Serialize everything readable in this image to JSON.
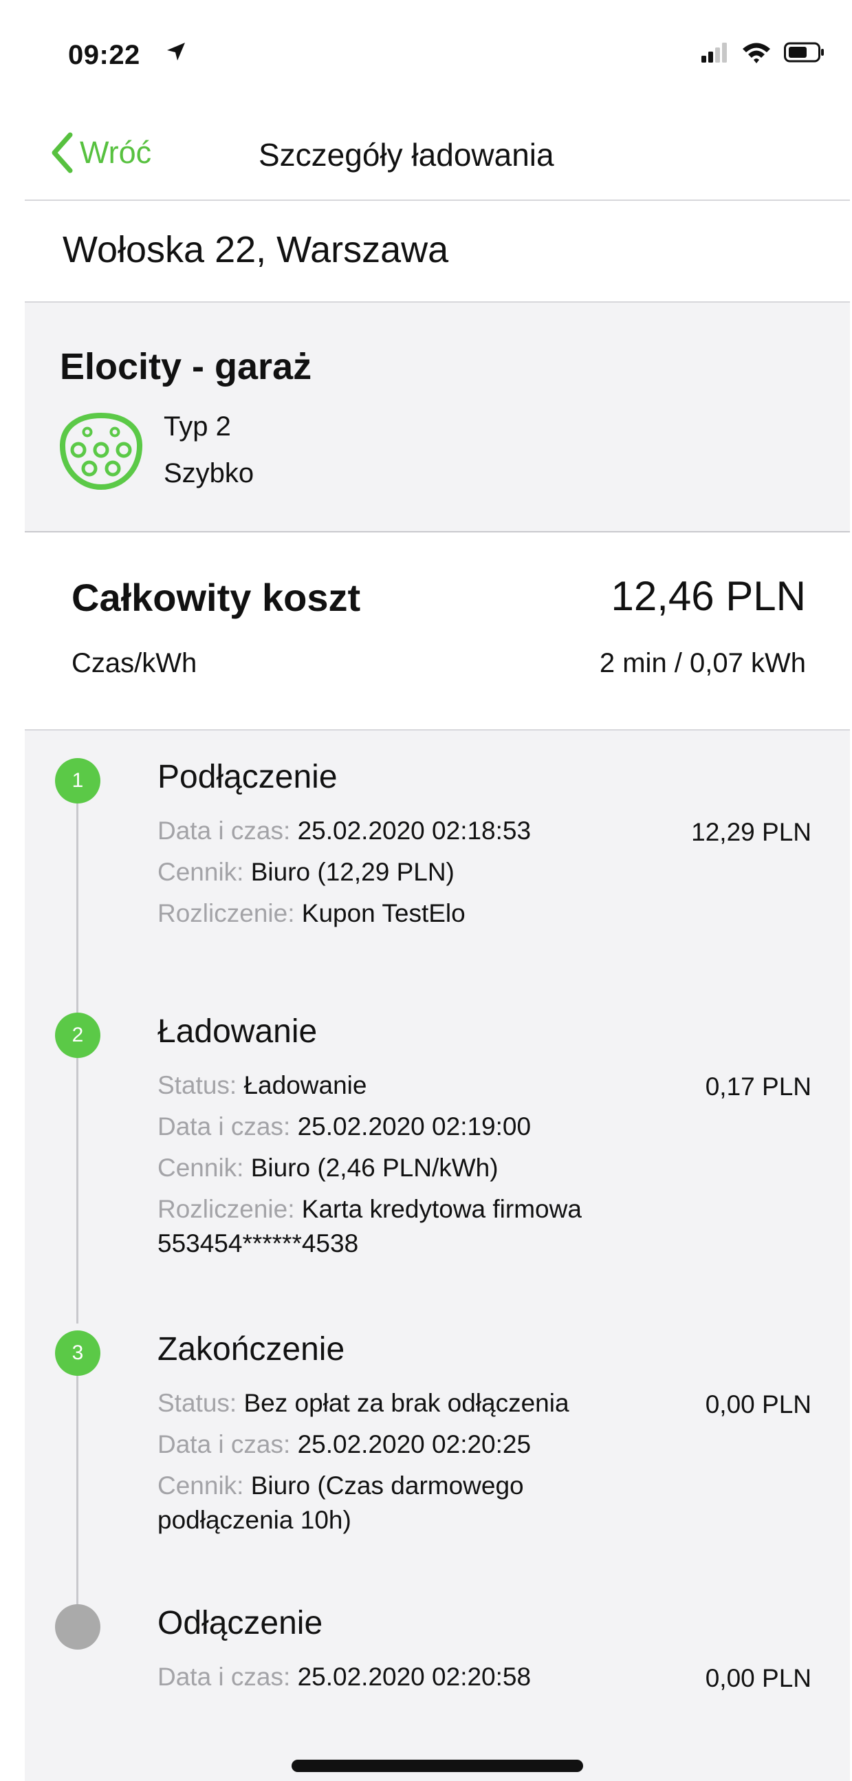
{
  "status_bar": {
    "time": "09:22"
  },
  "nav": {
    "back_label": "Wróć",
    "title": "Szczegóły ładowania"
  },
  "address": "Wołoska 22, Warszawa",
  "station": {
    "name": "Elocity - garaż",
    "plug_type": "Typ 2",
    "speed": "Szybko"
  },
  "summary": {
    "total_label": "Całkowity koszt",
    "total_value": "12,46 PLN",
    "time_label": "Czas/kWh",
    "time_value": "2 min / 0,07 kWh"
  },
  "labels": {
    "date_time": "Data i czas:",
    "tariff": "Cennik:",
    "billing": "Rozliczenie:",
    "status": "Status:"
  },
  "steps": [
    {
      "number": "1",
      "title": "Podłączenie",
      "amount": "12,29 PLN",
      "date_time": "25.02.2020 02:18:53",
      "tariff": "Biuro (12,29 PLN)",
      "billing": "Kupon TestElo"
    },
    {
      "number": "2",
      "title": "Ładowanie",
      "amount": "0,17 PLN",
      "status": "Ładowanie",
      "date_time": "25.02.2020 02:19:00",
      "tariff": "Biuro (2,46 PLN/kWh)",
      "billing_line1": "Karta kredytowa firmowa",
      "billing_line2": "553454******4538"
    },
    {
      "number": "3",
      "title": "Zakończenie",
      "amount": "0,00 PLN",
      "status": "Bez opłat za brak odłączenia",
      "date_time": "25.02.2020 02:20:25",
      "tariff_line1": "Biuro (Czas darmowego",
      "tariff_line2": "podłączenia 10h)"
    },
    {
      "title": "Odłączenie",
      "amount": "0,00 PLN",
      "date_time": "25.02.2020 02:20:58"
    }
  ],
  "colors": {
    "accent": "#57c13f",
    "step_done": "#5bc947",
    "step_pending": "#aaaaaa",
    "label_gray": "#a3a3a7"
  }
}
